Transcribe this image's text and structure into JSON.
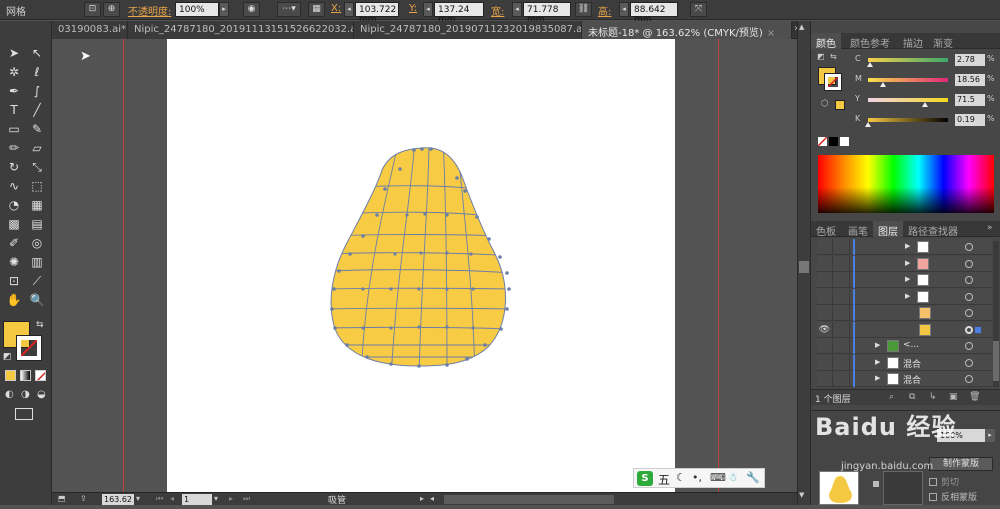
{
  "control_bar": {
    "mode_label": "网格",
    "opacity_label": "不透明度:",
    "opacity_value": "100%",
    "x_label": "X:",
    "x_value": "103.722",
    "y_label": "Y:",
    "y_value": "137.24",
    "w_label": "宽:",
    "w_value": "71.778",
    "h_label": "高:",
    "h_value": "88.642",
    "unit": "mm"
  },
  "tabs": [
    {
      "label": "03190083.ai*",
      "active": false
    },
    {
      "label": "Nipic_24787180_20191113151526622032.ai*",
      "active": false
    },
    {
      "label": "Nipic_24787180_20190711232019835087.ai*",
      "active": false
    },
    {
      "label": "未标题-18* @ 163.62% (CMYK/预览)",
      "active": true
    }
  ],
  "tab_close_glyph": "×",
  "tab_overflow_glyph": "»",
  "tools": [
    {
      "icon": "selection-icon",
      "glyph": "➤"
    },
    {
      "icon": "direct-selection-icon",
      "glyph": "↖"
    },
    {
      "icon": "magic-wand-icon",
      "glyph": "✲"
    },
    {
      "icon": "lasso-icon",
      "glyph": "ℓ"
    },
    {
      "icon": "pen-icon",
      "glyph": "✒"
    },
    {
      "icon": "curvature-icon",
      "glyph": "∫"
    },
    {
      "icon": "type-icon",
      "glyph": "T"
    },
    {
      "icon": "line-segment-icon",
      "glyph": "╱"
    },
    {
      "icon": "rectangle-icon",
      "glyph": "▭"
    },
    {
      "icon": "paintbrush-icon",
      "glyph": "✎"
    },
    {
      "icon": "pencil-icon",
      "glyph": "✏"
    },
    {
      "icon": "eraser-icon",
      "glyph": "▱"
    },
    {
      "icon": "rotate-icon",
      "glyph": "↻"
    },
    {
      "icon": "scale-icon",
      "glyph": "⤡"
    },
    {
      "icon": "warp-icon",
      "glyph": "∿"
    },
    {
      "icon": "free-transform-icon",
      "glyph": "⬚"
    },
    {
      "icon": "shape-builder-icon",
      "glyph": "◔"
    },
    {
      "icon": "perspective-grid-icon",
      "glyph": "▦"
    },
    {
      "icon": "mesh-icon",
      "glyph": "▩"
    },
    {
      "icon": "gradient-icon",
      "glyph": "▤"
    },
    {
      "icon": "eyedropper-icon",
      "glyph": "✐"
    },
    {
      "icon": "blend-icon",
      "glyph": "◎"
    },
    {
      "icon": "symbol-sprayer-icon",
      "glyph": "✺"
    },
    {
      "icon": "column-graph-icon",
      "glyph": "▥"
    },
    {
      "icon": "artboard-icon",
      "glyph": "⊡"
    },
    {
      "icon": "slice-icon",
      "glyph": "⟋"
    },
    {
      "icon": "hand-icon",
      "glyph": "✋"
    },
    {
      "icon": "zoom-icon",
      "glyph": "🔍"
    }
  ],
  "status_bar": {
    "zoom": "163.62",
    "artboard": "1",
    "tool_name": "吸管"
  },
  "color_panel": {
    "tabs": [
      "颜色",
      "颜色参考",
      "描边",
      "渐变"
    ],
    "fill_color": "#f5c842",
    "sliders": [
      {
        "letter": "C",
        "value": "2.78",
        "fraction": 0.028,
        "gradient": "linear-gradient(90deg,#f7d14a,#3ba76a)"
      },
      {
        "letter": "M",
        "value": "18.56",
        "fraction": 0.186,
        "gradient": "linear-gradient(90deg,#f7e04a,#e1287a)"
      },
      {
        "letter": "Y",
        "value": "71.5",
        "fraction": 0.715,
        "gradient": "linear-gradient(90deg,#f2d4e8,#f4d81d)"
      },
      {
        "letter": "K",
        "value": "0.19",
        "fraction": 0.002,
        "gradient": "linear-gradient(90deg,#f5c842,#000)"
      }
    ],
    "unit": "%"
  },
  "layers_panel": {
    "tabs": [
      "色板",
      "画笔",
      "图层",
      "路径查找器"
    ],
    "rows": [
      {
        "name": "",
        "thumb_color": "#ffffff",
        "indent": 1
      },
      {
        "name": "",
        "thumb_color": "#f2a5a0",
        "indent": 1
      },
      {
        "name": "",
        "thumb_color": "#ffffff",
        "indent": 1
      },
      {
        "name": "",
        "thumb_color": "#ffffff",
        "indent": 1
      },
      {
        "name": "",
        "thumb_color": "#f5c16a",
        "indent": 2
      },
      {
        "name": "",
        "thumb_color": "#f5c842",
        "indent": 2,
        "selected": true
      },
      {
        "name": "<...",
        "thumb_color": "#4a9a3a",
        "indent": 0
      },
      {
        "name": "混合",
        "thumb_color": "#ffffff",
        "indent": 0
      },
      {
        "name": "混合",
        "thumb_color": "#ffffff",
        "indent": 0
      }
    ],
    "footer": "1 个图层"
  },
  "bottom_panel": {
    "make_mask_label": "制作蒙版",
    "clip_label": "剪切",
    "invert_mask_label": "反相蒙版",
    "opacity_value": "100%",
    "watermark": "Baidu 经验",
    "watermark_url": "jingyan.baidu.com"
  },
  "ime_bar": {
    "label": "五",
    "icons": [
      "moon-icon",
      "punctuation-icon",
      "keyboard-icon",
      "skin-icon",
      "wrench-icon"
    ]
  }
}
